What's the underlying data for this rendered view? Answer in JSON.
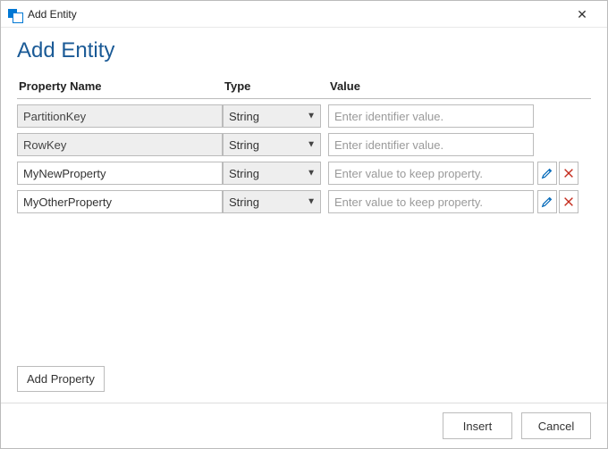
{
  "window": {
    "title": "Add Entity"
  },
  "header": {
    "title": "Add Entity"
  },
  "columns": {
    "name": "Property Name",
    "type": "Type",
    "value": "Value"
  },
  "rows": [
    {
      "name": "PartitionKey",
      "name_readonly": true,
      "type": "String",
      "value": "",
      "value_placeholder": "Enter identifier value.",
      "editable_actions": false
    },
    {
      "name": "RowKey",
      "name_readonly": true,
      "type": "String",
      "value": "",
      "value_placeholder": "Enter identifier value.",
      "editable_actions": false
    },
    {
      "name": "MyNewProperty",
      "name_readonly": false,
      "type": "String",
      "value": "",
      "value_placeholder": "Enter value to keep property.",
      "editable_actions": true
    },
    {
      "name": "MyOtherProperty",
      "name_readonly": false,
      "type": "String",
      "value": "",
      "value_placeholder": "Enter value to keep property.",
      "editable_actions": true
    }
  ],
  "type_options": [
    "String"
  ],
  "buttons": {
    "add_property": "Add Property",
    "insert": "Insert",
    "cancel": "Cancel"
  }
}
